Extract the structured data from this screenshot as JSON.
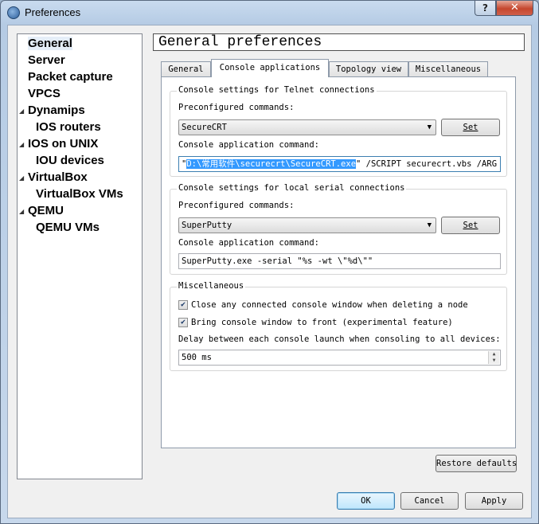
{
  "window": {
    "title": "Preferences",
    "help_label": "?",
    "close_label": "✕"
  },
  "nav": {
    "items": [
      {
        "label": "General",
        "expandable": false,
        "indent": 0
      },
      {
        "label": "Server",
        "expandable": false,
        "indent": 0
      },
      {
        "label": "Packet capture",
        "expandable": false,
        "indent": 0
      },
      {
        "label": "VPCS",
        "expandable": false,
        "indent": 0
      },
      {
        "label": "Dynamips",
        "expandable": true,
        "indent": 0
      },
      {
        "label": "IOS routers",
        "expandable": false,
        "indent": 1
      },
      {
        "label": "IOS on UNIX",
        "expandable": true,
        "indent": 0
      },
      {
        "label": "IOU devices",
        "expandable": false,
        "indent": 1
      },
      {
        "label": "VirtualBox",
        "expandable": true,
        "indent": 0
      },
      {
        "label": "VirtualBox VMs",
        "expandable": false,
        "indent": 1
      },
      {
        "label": "QEMU",
        "expandable": true,
        "indent": 0
      },
      {
        "label": "QEMU VMs",
        "expandable": false,
        "indent": 1
      }
    ],
    "selected": "General"
  },
  "page_header": "General preferences",
  "tabs": [
    "General",
    "Console applications",
    "Topology view",
    "Miscellaneous"
  ],
  "active_tab": "Console applications",
  "telnet": {
    "title": "Console settings for Telnet connections",
    "preconf_label": "Preconfigured commands:",
    "preconf_value": "SecureCRT",
    "set_label": "Set",
    "cmd_label": "Console application command:",
    "cmd_prefix": "\"",
    "cmd_selected": "D:\\常用软件\\securecrt\\SecureCRT.exe",
    "cmd_suffix": "\" /SCRIPT securecrt.vbs /ARG \"%"
  },
  "serial": {
    "title": "Console settings for local serial connections",
    "preconf_label": "Preconfigured commands:",
    "preconf_value": "SuperPutty",
    "set_label": "Set",
    "cmd_label": "Console application command:",
    "cmd_value": "SuperPutty.exe -serial \"%s -wt \\\"%d\\\"\""
  },
  "misc": {
    "title": "Miscellaneous",
    "close_console_label": "Close any connected console window when deleting a node",
    "close_console_checked": true,
    "bring_front_label": "Bring console window to front (experimental feature)",
    "bring_front_checked": true,
    "delay_label": "Delay between each console launch when consoling to all devices:",
    "delay_value": "500 ms"
  },
  "restore_defaults_label": "Restore defaults",
  "buttons": {
    "ok": "OK",
    "cancel": "Cancel",
    "apply": "Apply"
  },
  "icons": {
    "check": "✔",
    "combo_arrow": "▼",
    "spin_up": "▲",
    "spin_down": "▼",
    "expand": "◢"
  }
}
